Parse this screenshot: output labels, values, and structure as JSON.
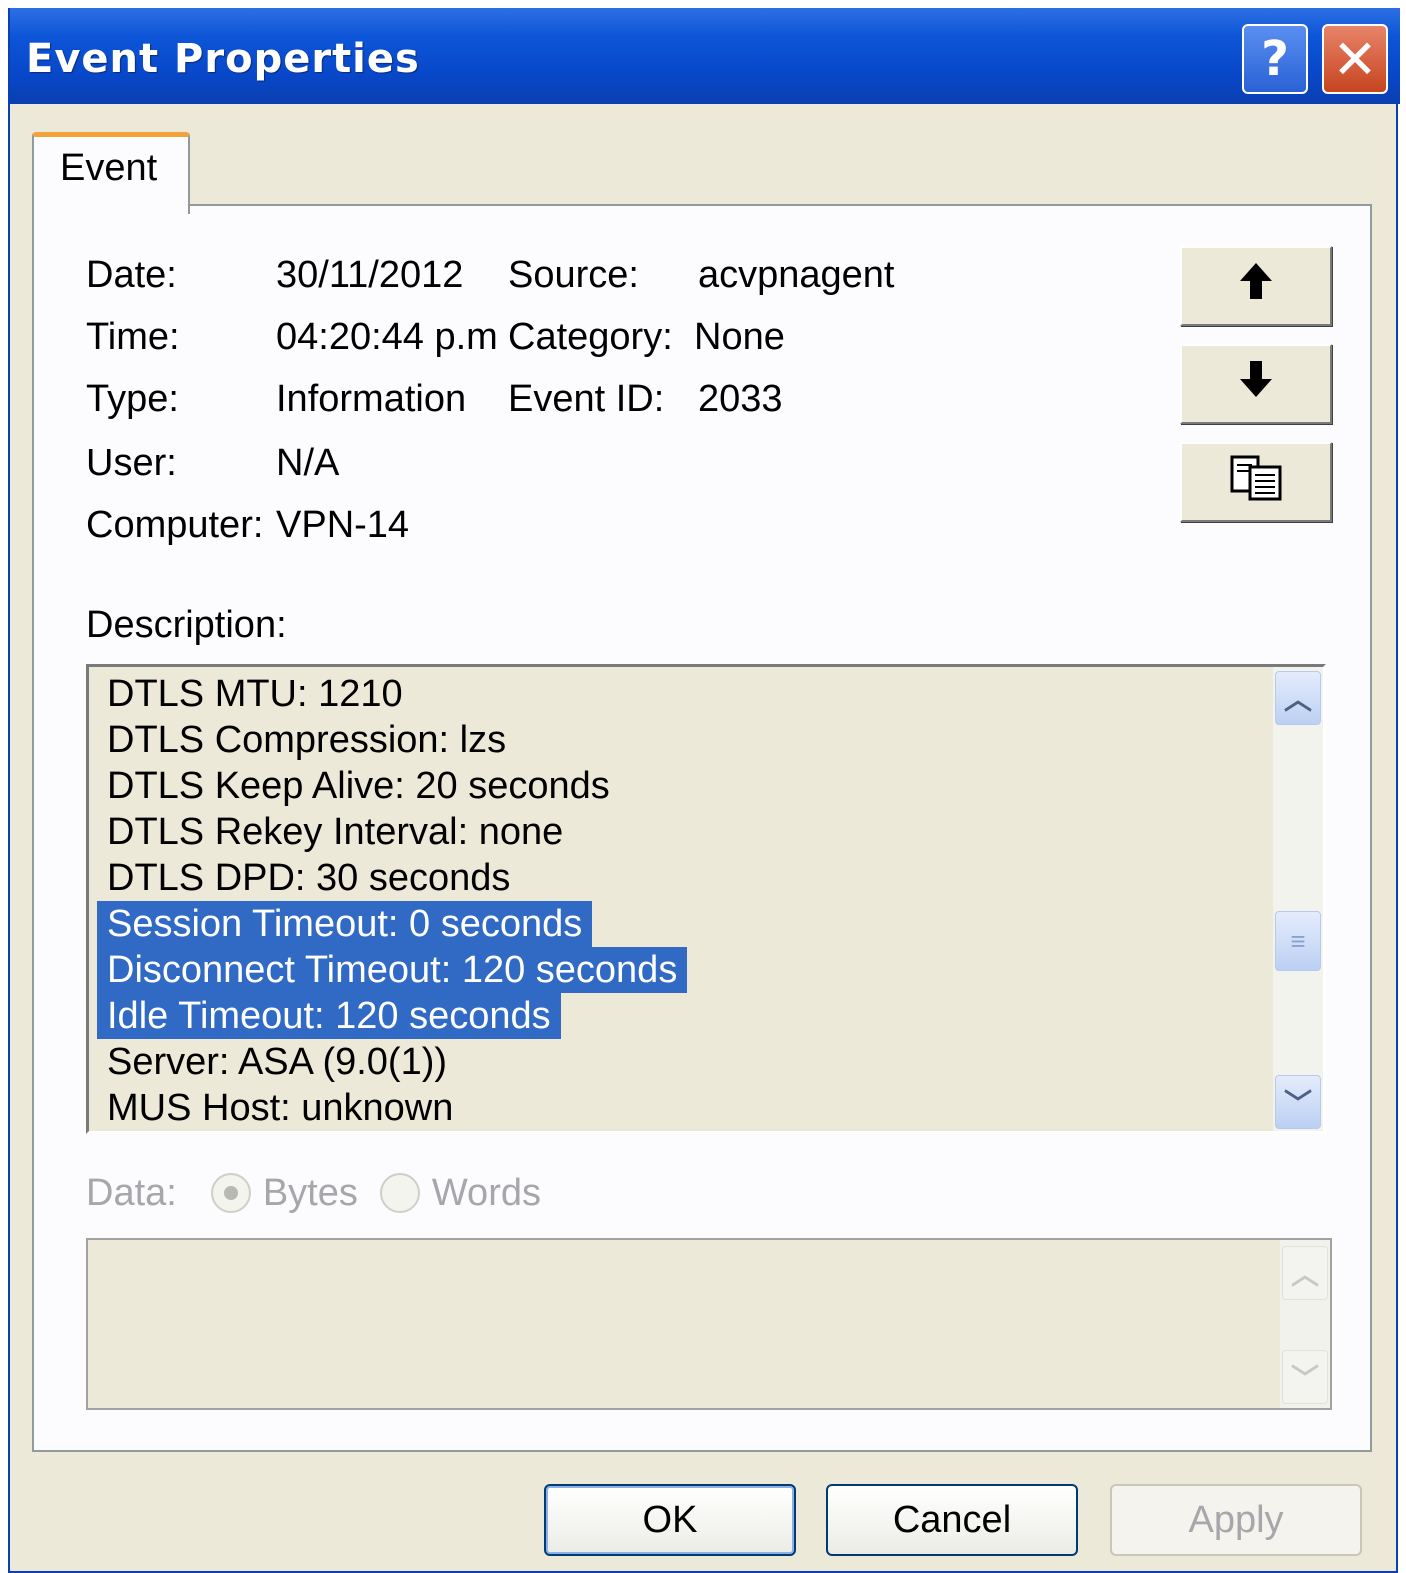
{
  "window": {
    "title": "Event Properties",
    "help_label": "?",
    "close_label": "✕"
  },
  "tabs": [
    {
      "label": "Event"
    }
  ],
  "event": {
    "date_label": "Date:",
    "date": "30/11/2012",
    "time_label": "Time:",
    "time": "04:20:44 p.m",
    "type_label": "Type:",
    "type": "Information",
    "user_label": "User:",
    "user": "N/A",
    "computer_label": "Computer:",
    "computer": "VPN-14",
    "source_label": "Source:",
    "source": "acvpnagent",
    "category_label": "Category:",
    "category": "None",
    "event_id_label": "Event ID:",
    "event_id": "2033"
  },
  "side_buttons": {
    "up_icon": "arrow-up-icon",
    "down_icon": "arrow-down-icon",
    "copy_icon": "copy-icon"
  },
  "description": {
    "label": "Description:",
    "lines": [
      {
        "text": "DTLS MTU: 1210",
        "selected": false
      },
      {
        "text": "DTLS Compression: lzs",
        "selected": false
      },
      {
        "text": "DTLS Keep Alive: 20 seconds",
        "selected": false
      },
      {
        "text": "DTLS Rekey Interval: none",
        "selected": false
      },
      {
        "text": "DTLS DPD: 30 seconds",
        "selected": false
      },
      {
        "text": "Session Timeout: 0 seconds",
        "selected": true
      },
      {
        "text": "Disconnect Timeout: 120 seconds",
        "selected": true
      },
      {
        "text": "Idle Timeout: 120 seconds",
        "selected": true
      },
      {
        "text": "Server: ASA (9.0(1))",
        "selected": false
      },
      {
        "text": "MUS Host: unknown",
        "selected": false
      }
    ]
  },
  "data_section": {
    "label": "Data:",
    "options": [
      "Bytes",
      "Words"
    ],
    "selected": "Bytes",
    "enabled": false
  },
  "buttons": {
    "ok": "OK",
    "cancel": "Cancel",
    "apply": "Apply"
  },
  "colors": {
    "selection": "#316ac5",
    "titlebar": "#0847c9",
    "tab_accent": "#f4a33a"
  }
}
